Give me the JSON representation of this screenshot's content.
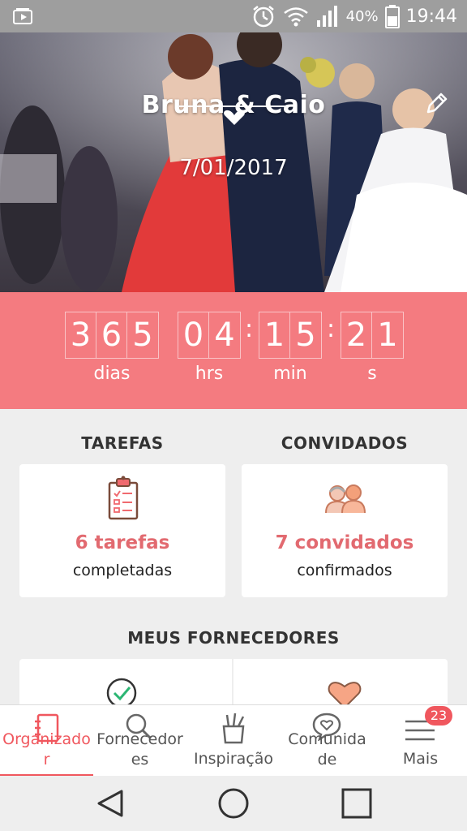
{
  "status_bar": {
    "battery_percent": "40%",
    "time": "19:44",
    "icons": [
      "media-icon",
      "alarm-icon",
      "wifi-icon",
      "signal-icon",
      "battery-icon"
    ]
  },
  "hero": {
    "couple_names": "Bruna & Caio",
    "wedding_date": "7/01/2017",
    "edit_icon": "pencil-icon"
  },
  "countdown": {
    "days": [
      "3",
      "6",
      "5"
    ],
    "hours": [
      "0",
      "4"
    ],
    "minutes": [
      "1",
      "5"
    ],
    "seconds": [
      "2",
      "1"
    ],
    "labels": {
      "days": "dias",
      "hours": "hrs",
      "minutes": "min",
      "seconds": "s"
    },
    "colon": ":"
  },
  "tasks": {
    "heading": "TAREFAS",
    "count": "6 tarefas",
    "subtitle": "completadas",
    "icon": "clipboard-icon"
  },
  "guests": {
    "heading": "CONVIDADOS",
    "count": "7 convidados",
    "subtitle": "confirmados",
    "icon": "guests-icon"
  },
  "vendors": {
    "heading": "MEUS FORNECEDORES",
    "icons": [
      "check-circle-icon",
      "heart-icon"
    ]
  },
  "bottom_nav": {
    "items": [
      {
        "label_line1": "Organizado",
        "label_line2": "r",
        "icon": "notebook-icon",
        "active": true
      },
      {
        "label_line1": "Fornecedor",
        "label_line2": "es",
        "icon": "search-icon",
        "active": false
      },
      {
        "label_line1": "Inspiração",
        "label_line2": "",
        "icon": "brushes-icon",
        "active": false
      },
      {
        "label_line1": "Comunida",
        "label_line2": "de",
        "icon": "heart-bubble-icon",
        "active": false
      },
      {
        "label_line1": "Mais",
        "label_line2": "",
        "icon": "menu-icon",
        "active": false
      }
    ],
    "badge": "23"
  },
  "colors": {
    "accent": "#f47b80",
    "accent_text": "#e26a70",
    "status_bar": "#9e9e9e",
    "background": "#eeeeee"
  }
}
